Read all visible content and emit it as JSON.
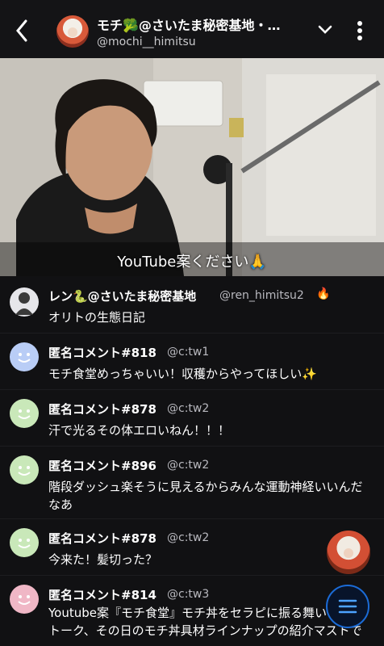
{
  "header": {
    "title": "モチ🥦@さいたま秘密基地・…",
    "handle": "@mochi__himitsu"
  },
  "video": {
    "caption": "YouTube案ください🙏"
  },
  "comments": [
    {
      "name": "レン🐍@さいたま秘密基地",
      "uid": "@ren_himitsu2",
      "text": "オリトの生態日記",
      "badge": "🔥"
    },
    {
      "name": "匿名コメント#818",
      "uid": "@c:tw1",
      "text": "モチ食堂めっちゃいい！収穫からやってほしい✨"
    },
    {
      "name": "匿名コメント#878",
      "uid": "@c:tw2",
      "text": "汗で光るその体エロいねん！！！"
    },
    {
      "name": "匿名コメント#896",
      "uid": "@c:tw2",
      "text": "階段ダッシュ楽そうに見えるからみんな運動神経いいんだなあ"
    },
    {
      "name": "匿名コメント#878",
      "uid": "@c:tw2",
      "text": "今来た！髪切った？"
    },
    {
      "name": "匿名コメント#814",
      "uid": "@c:tw3",
      "text": "Youtube案『モチ食堂』モチ丼をセラピに振る舞いながらトーク、その日のモチ丼具材ラインナップの紹介マストで◎"
    }
  ],
  "colors": {
    "blue_avatar": "#b9cdf6",
    "green_avatar": "#c9e8b9",
    "pink_avatar": "#f0b7c6",
    "accent": "#1b6bd6"
  }
}
